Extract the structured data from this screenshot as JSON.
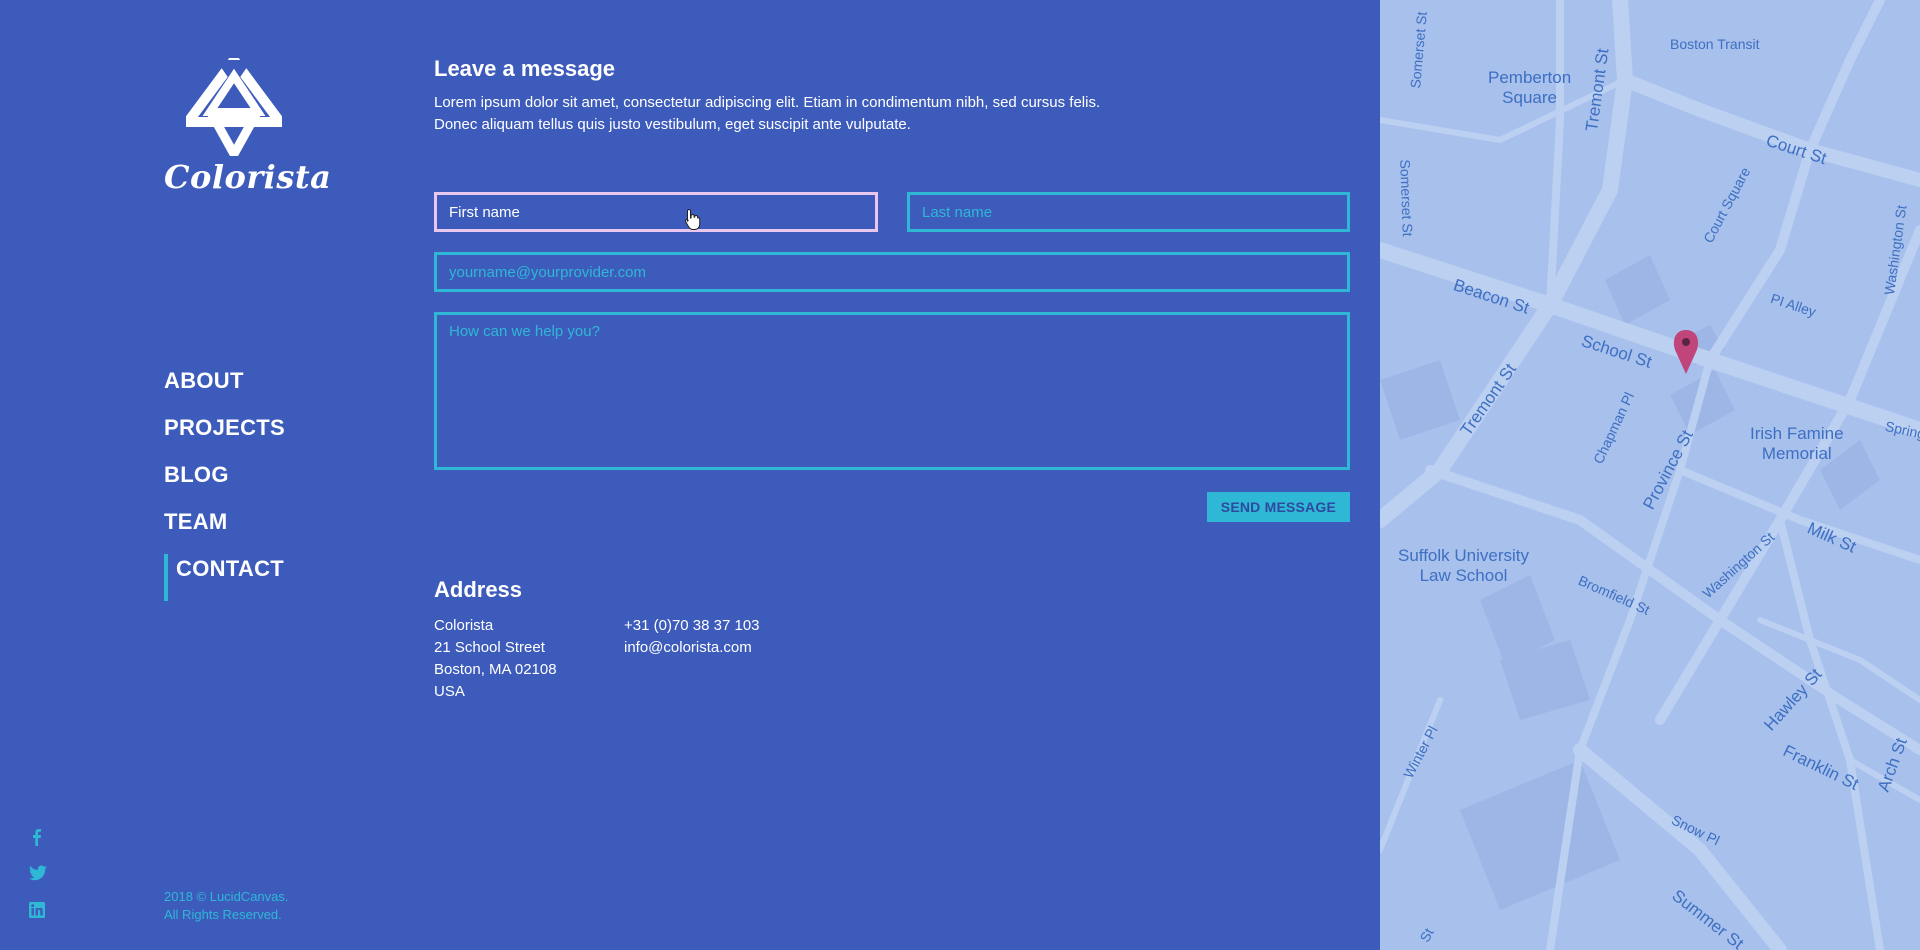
{
  "brand": {
    "name": "Colorista",
    "logo_icon": "diamond-triangles-logo"
  },
  "nav": {
    "items": [
      {
        "label": "ABOUT",
        "active": false
      },
      {
        "label": "PROJECTS",
        "active": false
      },
      {
        "label": "BLOG",
        "active": false
      },
      {
        "label": "TEAM",
        "active": false
      },
      {
        "label": "CONTACT",
        "active": true
      }
    ]
  },
  "social": {
    "icons": [
      "facebook-icon",
      "twitter-icon",
      "linkedin-icon"
    ]
  },
  "footer": {
    "copyright_line1": "2018 © LucidCanvas.",
    "copyright_line2": "All Rights Reserved."
  },
  "form": {
    "title": "Leave a message",
    "intro_line1": "Lorem ipsum dolor sit amet, consectetur adipiscing elit. Etiam in condimentum nibh, sed cursus felis.",
    "intro_line2": "Donec aliquam tellus quis justo vestibulum, eget suscipit ante vulputate.",
    "first_name_placeholder": "First name",
    "last_name_placeholder": "Last name",
    "email_placeholder": "yourname@yourprovider.com",
    "message_placeholder": "How can we help you?",
    "send_label": "SEND MESSAGE"
  },
  "address": {
    "title": "Address",
    "company": "Colorista",
    "street": "21 School Street",
    "city": "Boston, MA 02108",
    "country": "USA",
    "phone": "+31 (0)70 38 37 103",
    "email": "info@colorista.com"
  },
  "map": {
    "labels": {
      "pemberton_1": "Pemberton",
      "pemberton_2": "Square",
      "boston_transit": "Boston Transit",
      "court_st": "Court St",
      "court_square": "Court Square",
      "tremont_top": "Tremont St",
      "tremont_mid": "Tremont St",
      "somerset_top": "Somerset St",
      "somerset_mid": "Somerset St",
      "beacon_st": "Beacon St",
      "school_st": "School St",
      "pi_alley": "PI Alley",
      "washington_top": "Washington St",
      "chapman_pl": "Chapman Pl",
      "province_st": "Province St",
      "irish_1": "Irish Famine",
      "irish_2": "Memorial",
      "spring": "Spring",
      "suffolk_1": "Suffolk University",
      "suffolk_2": "Law School",
      "bromfield_st": "Bromfield St",
      "washington_mid": "Washington St",
      "milk_st": "Milk St",
      "hawley_st": "Hawley St",
      "franklin_st": "Franklin St",
      "arch_st": "Arch St",
      "winter_pl": "Winter Pl",
      "snow_pl": "Snow Pl",
      "summer_st": "Summer St",
      "st_bottom": "St"
    },
    "marker_color": "#c0457a"
  },
  "colors": {
    "background": "#3d5bbb",
    "accent": "#2fb7d6",
    "focus_border": "#e8c8f0",
    "map_background": "#a8c0ec"
  }
}
